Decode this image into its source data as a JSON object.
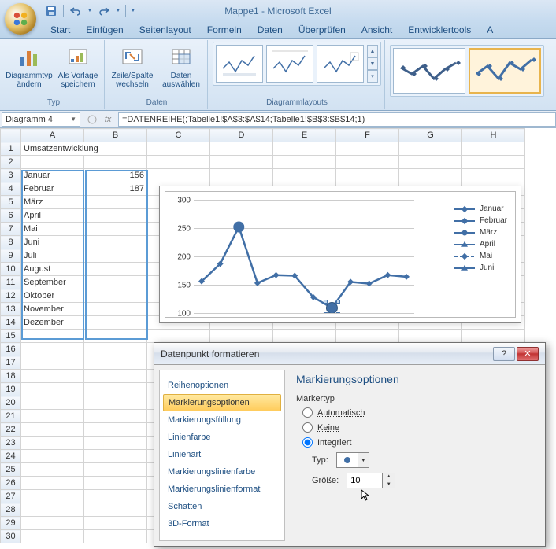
{
  "window": {
    "title": "Mappe1 - Microsoft Excel"
  },
  "qat": {
    "save": "💾",
    "undo": "↶",
    "redo": "↷"
  },
  "tabs": [
    "Start",
    "Einfügen",
    "Seitenlayout",
    "Formeln",
    "Daten",
    "Überprüfen",
    "Ansicht",
    "Entwicklertools",
    "A"
  ],
  "ribbon": {
    "group1": {
      "label": "Typ",
      "btn1": "Diagrammtyp ändern",
      "btn2": "Als Vorlage speichern"
    },
    "group2": {
      "label": "Daten",
      "btn1": "Zeile/Spalte wechseln",
      "btn2": "Daten auswählen"
    },
    "group3": {
      "label": "Diagrammlayouts"
    }
  },
  "namebox": "Diagramm 4",
  "formula": "=DATENREIHE(;Tabelle1!$A$3:$A$14;Tabelle1!$B$3:$B$14;1)",
  "columns": [
    "A",
    "B",
    "C",
    "D",
    "E",
    "F",
    "G",
    "H"
  ],
  "data": {
    "title": "Umsatzentwicklung",
    "rows": [
      {
        "m": "Januar",
        "v": "156"
      },
      {
        "m": "Februar",
        "v": "187"
      },
      {
        "m": "März",
        "v": ""
      },
      {
        "m": "April",
        "v": ""
      },
      {
        "m": "Mai",
        "v": ""
      },
      {
        "m": "Juni",
        "v": ""
      },
      {
        "m": "Juli",
        "v": ""
      },
      {
        "m": "August",
        "v": ""
      },
      {
        "m": "September",
        "v": ""
      },
      {
        "m": "Oktober",
        "v": ""
      },
      {
        "m": "November",
        "v": ""
      },
      {
        "m": "Dezember",
        "v": ""
      }
    ]
  },
  "chart_data": {
    "type": "line",
    "title": "",
    "xlabel": "",
    "ylabel": "",
    "ylim": [
      100,
      300
    ],
    "yticks": [
      100,
      150,
      200,
      250,
      300
    ],
    "categories": [
      "Januar",
      "Februar",
      "März",
      "April",
      "Mai",
      "Juni",
      "Juli",
      "August",
      "September",
      "Oktober",
      "November",
      "Dezember"
    ],
    "values": [
      156,
      187,
      252,
      153,
      167,
      166,
      128,
      109,
      155,
      152,
      167,
      164
    ],
    "selected_point_index": 2,
    "legend_visible": [
      "Januar",
      "Februar",
      "März",
      "April",
      "Mai",
      "Juni"
    ]
  },
  "dialog": {
    "title": "Datenpunkt formatieren",
    "side": [
      "Reihenoptionen",
      "Markierungsoptionen",
      "Markierungsfüllung",
      "Linienfarbe",
      "Linienart",
      "Markierungslinienfarbe",
      "Markierungslinienformat",
      "Schatten",
      "3D-Format"
    ],
    "side_active": 1,
    "heading": "Markierungsoptionen",
    "fieldset": "Markertyp",
    "radios": [
      "Automatisch",
      "Keine",
      "Integriert"
    ],
    "radio_selected": 2,
    "type_label": "Typ:",
    "size_label": "Größe:",
    "size_value": "10"
  }
}
